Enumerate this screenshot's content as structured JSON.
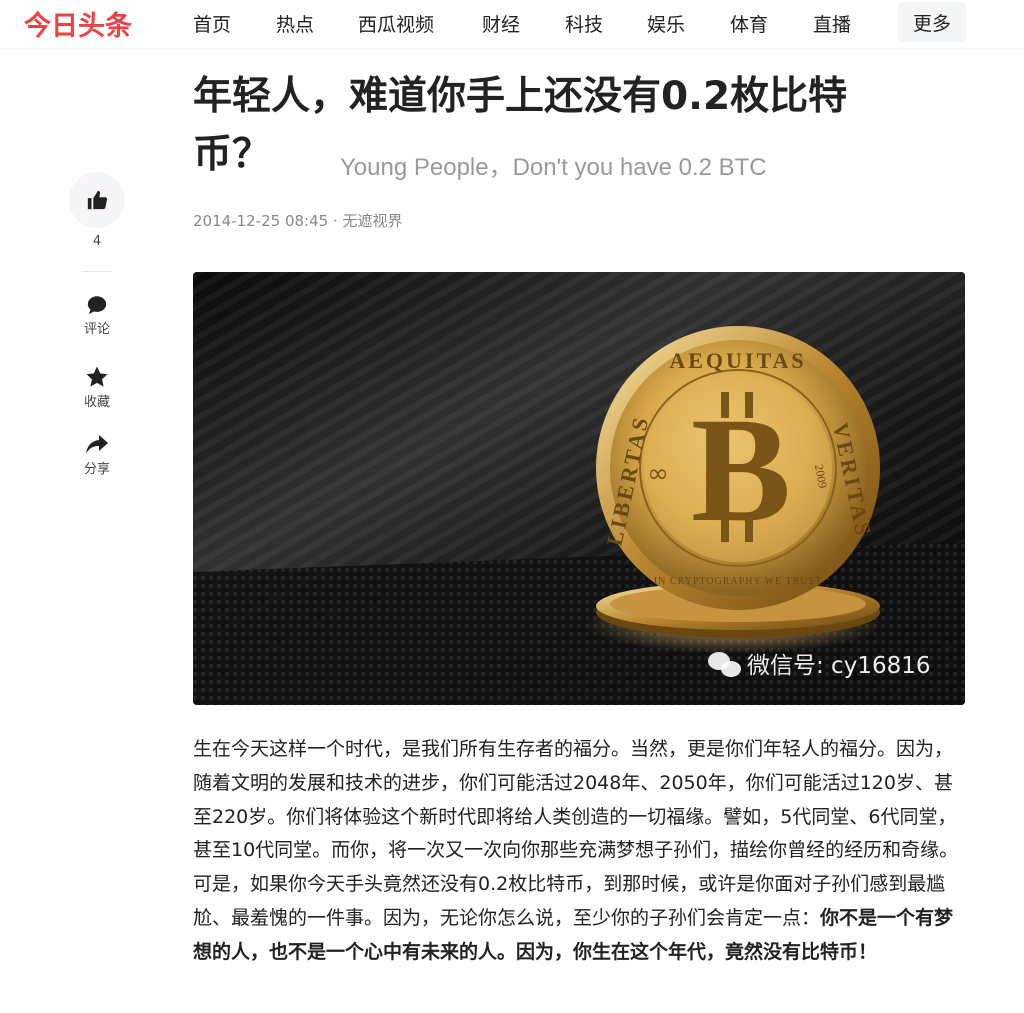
{
  "header": {
    "logo": "今日头条",
    "nav": [
      "首页",
      "热点",
      "西瓜视频",
      "财经",
      "科技",
      "娱乐",
      "体育",
      "直播"
    ],
    "more": "更多"
  },
  "sidebar": {
    "like_count": "4",
    "comment_label": "评论",
    "collect_label": "收藏",
    "share_label": "分享"
  },
  "article": {
    "title_line1": "年轻人，难道你手上还没有0.2枚比特",
    "title_line2": "币？",
    "subtitle": "Young People，Don't you have 0.2 BTC",
    "date": "2014-12-25 08:45",
    "separator": "·",
    "source": "无遮视界",
    "image": {
      "coin_top_text": "AEQUITAS",
      "coin_left_text": "LIBERTAS",
      "coin_right_text": "VERITAS",
      "coin_bottom_text": "IN CRYPTOGRAPHY WE TRUST",
      "coin_year": "2009",
      "coin_letter": "B",
      "watermark": "微信号: cy16816"
    },
    "paragraph_plain": "生在今天这样一个时代，是我们所有生存者的福分。当然，更是你们年轻人的福分。因为，随着文明的发展和技术的进步，你们可能活过2048年、2050年，你们可能活过120岁、甚至220岁。你们将体验这个新时代即将给人类创造的一切福缘。譬如，5代同堂、6代同堂，甚至10代同堂。而你，将一次又一次向你那些充满梦想子孙们，描绘你曾经的经历和奇缘。可是，如果你今天手头竟然还没有0.2枚比特币，到那时候，或许是你面对子孙们感到最尴尬、最羞愧的一件事。因为，无论你怎么说，至少你的子孙们会肯定一点：",
    "paragraph_bold": "你不是一个有梦想的人，也不是一个心中有未来的人。因为，你生在这个年代，竟然没有比特币！"
  },
  "colors": {
    "brand_red": "#f04142",
    "muted_text": "#999999",
    "coin_gold": "#d8a84a"
  }
}
